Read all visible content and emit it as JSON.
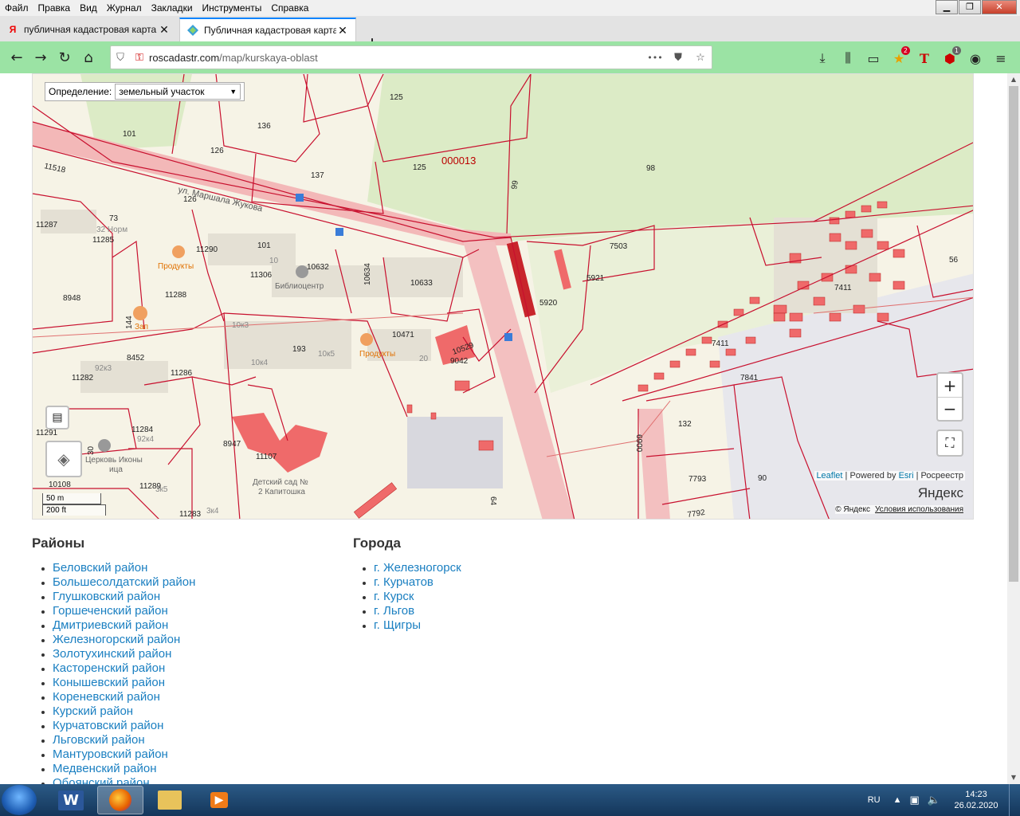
{
  "menu": [
    "Файл",
    "Правка",
    "Вид",
    "Журнал",
    "Закладки",
    "Инструменты",
    "Справка"
  ],
  "window_controls": {
    "minimize": "▁",
    "maximize": "❐",
    "close": "✕"
  },
  "tabs": [
    {
      "title": "публичная кадастровая карта",
      "icon": "yandex-icon"
    },
    {
      "title": "Публичная кадастровая карта",
      "icon": "roscadastr-icon"
    }
  ],
  "newtab_label": "+",
  "url": {
    "host": "roscadastr.com",
    "path": "/map/kurskaya-oblast",
    "more": "•••"
  },
  "toolbar_badges": {
    "pocket_count": "2",
    "abp_count": "1"
  },
  "map": {
    "definition_label": "Определение:",
    "definition_value": "земельный участок",
    "zoom_in": "+",
    "zoom_out": "−",
    "attribution": {
      "leaflet": "Leaflet",
      "powered": " | Powered by ",
      "esri": "Esri",
      "rosreestr": " | Росреестр"
    },
    "yandex_logo": "Яндекс",
    "yandex_copy": "© Яндекс",
    "yandex_terms": "Условия использования",
    "scale_m": "50 m",
    "scale_ft": "200 ft",
    "labels": {
      "l125a": "125",
      "l136": "136",
      "l101": "101",
      "l126a": "126",
      "l11518": "11518",
      "l137": "137",
      "l125b": "125",
      "l000013": "000013",
      "l98": "98",
      "l99": "99",
      "street": "ул. Маршала Жукова",
      "l126b": "126",
      "l11287": "11287",
      "l73": "73",
      "l32norm": "32 Норм",
      "l11285": "11285",
      "l11290": "11290",
      "l101b": "101",
      "produkty1": "Продукты",
      "l10": "10",
      "l10632": "10632",
      "l10634": "10634",
      "l11306": "11306",
      "bibliocenter": "Библиоцентр",
      "l10633": "10633",
      "l7503": "7503",
      "l5921": "5921",
      "l5920": "5920",
      "l56": "56",
      "l7411a": "7411",
      "l8948": "8948",
      "l11288": "11288",
      "l144": "144",
      "zap": "Зап",
      "l10k3": "10к3",
      "l10471": "10471",
      "l193": "193",
      "l10k5": "10к5",
      "produkty2": "Продукты",
      "l10529": "10529",
      "l9042": "9042",
      "l20": "20",
      "l10k4": "10к4",
      "l7411b": "7411",
      "l8452": "8452",
      "l92k3": "92к3",
      "l11282": "11282",
      "l11286": "11286",
      "l7841": "7841",
      "l132": "132",
      "l6900": "6900",
      "l8947": "8947",
      "l11107": "11107",
      "l11284": "11284",
      "l92k4": "92к4",
      "l30": "30",
      "church": "Церковь Иконы",
      "church2": "ица",
      "l11291": "11291",
      "l10108": "10108",
      "l11289": "11289",
      "kinder": "Детский сад №",
      "kinder2": "2 Капитошка",
      "l11283": "11283",
      "l3k4": "3к4",
      "l3k5": "3к5",
      "l64": "64",
      "l7793": "7793",
      "l7792": "7792",
      "l90": "90"
    }
  },
  "districts": {
    "title": "Районы",
    "items": [
      "Беловский район",
      "Большесолдатский район",
      "Глушковский район",
      "Горшеченский район",
      "Дмитриевский район",
      "Железногорский район",
      "Золотухинский район",
      "Касторенский район",
      "Конышевский район",
      "Кореневский район",
      "Курский район",
      "Курчатовский район",
      "Льговский район",
      "Мантуровский район",
      "Медвенский район",
      "Обоянский район"
    ]
  },
  "cities": {
    "title": "Города",
    "items": [
      "г. Железногорск",
      "г. Курчатов",
      "г. Курск",
      "г. Льгов",
      "г. Щигры"
    ]
  },
  "taskbar": {
    "lang": "RU",
    "time": "14:23",
    "date": "26.02.2020",
    "apps": [
      {
        "label": "W",
        "color": "#2b579a"
      },
      {
        "label": "",
        "color": "#e66000"
      },
      {
        "label": "",
        "color": "#e8c35b"
      },
      {
        "label": "▶",
        "color": "#f07b18"
      }
    ]
  }
}
